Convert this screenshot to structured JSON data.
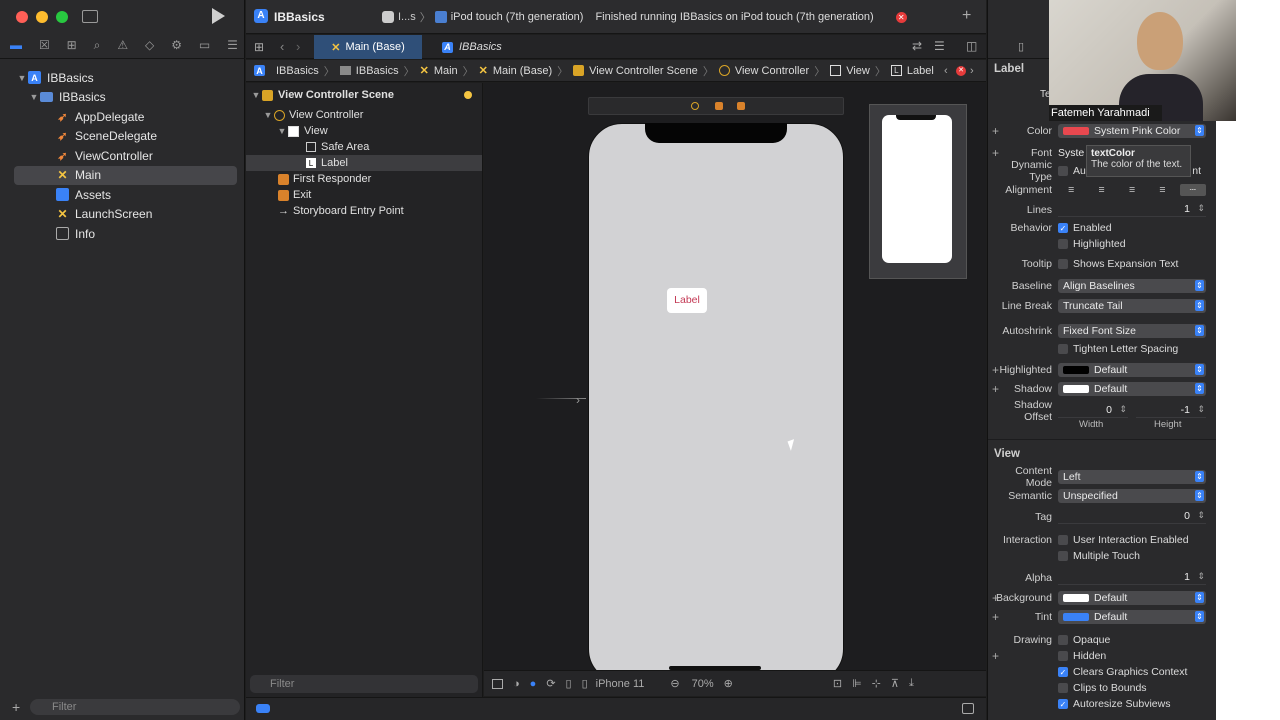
{
  "colors": {
    "accent": "#3a82f7",
    "pink": "#e8484f",
    "label_text": "#c43a55"
  },
  "window": {
    "scheme": "IBBasics",
    "scheme_short": "I...s",
    "device": "iPod touch (7th generation)",
    "status": "Finished running IBBasics on iPod touch (7th generation)"
  },
  "navigator": {
    "items": [
      {
        "label": "IBBasics",
        "icon": "project-icon",
        "level": 0
      },
      {
        "label": "IBBasics",
        "icon": "folder-icon",
        "level": 1
      },
      {
        "label": "AppDelegate",
        "icon": "swift-file-icon",
        "level": 2
      },
      {
        "label": "SceneDelegate",
        "icon": "swift-file-icon",
        "level": 2
      },
      {
        "label": "ViewController",
        "icon": "swift-file-icon",
        "level": 2
      },
      {
        "label": "Main",
        "icon": "storyboard-icon",
        "level": 2
      },
      {
        "label": "Assets",
        "icon": "assets-icon",
        "level": 2
      },
      {
        "label": "LaunchScreen",
        "icon": "storyboard-icon",
        "level": 2
      },
      {
        "label": "Info",
        "icon": "plist-icon",
        "level": 2
      }
    ],
    "filter_placeholder": "Filter"
  },
  "tabs": {
    "active": "Main (Base)",
    "other": "IBBasics"
  },
  "jumpbar": [
    "IBBasics",
    "IBBasics",
    "Main",
    "Main (Base)",
    "View Controller Scene",
    "View Controller",
    "View",
    "Label"
  ],
  "outline": {
    "items": [
      "View Controller Scene",
      "View Controller",
      "View",
      "Safe Area",
      "Label",
      "First Responder",
      "Exit",
      "Storyboard Entry Point"
    ],
    "filter_placeholder": "Filter"
  },
  "canvas": {
    "label_text": "Label",
    "device_name": "iPhone 11",
    "zoom": "70%"
  },
  "inspector": {
    "label_section": "Label",
    "text_label": "Te",
    "color_label": "Color",
    "color_value": "System Pink Color",
    "font_label": "Font",
    "font_value": "Syste",
    "tooltip_title": "textColor",
    "tooltip_body": "The color of the text.",
    "dynamic_label": "Dynamic Type",
    "dynamic_value": "Au",
    "dynamic_suffix": "nt",
    "alignment_label": "Alignment",
    "lines_label": "Lines",
    "lines_value": "1",
    "behavior_label": "Behavior",
    "enabled": "Enabled",
    "highlighted_chk": "Highlighted",
    "tooltip_label": "Tooltip",
    "shows_expansion": "Shows Expansion Text",
    "baseline_label": "Baseline",
    "baseline_value": "Align Baselines",
    "linebreak_label": "Line Break",
    "linebreak_value": "Truncate Tail",
    "autoshrink_label": "Autoshrink",
    "autoshrink_value": "Fixed Font Size",
    "tighten": "Tighten Letter Spacing",
    "highlighted_label": "Highlighted",
    "highlighted_value": "Default",
    "shadow_label": "Shadow",
    "shadow_value": "Default",
    "shadow_offset_label": "Shadow Offset",
    "shadow_w": "0",
    "shadow_h": "-1",
    "width_caption": "Width",
    "height_caption": "Height",
    "view_section": "View",
    "content_mode_label": "Content Mode",
    "content_mode_value": "Left",
    "semantic_label": "Semantic",
    "semantic_value": "Unspecified",
    "tag_label": "Tag",
    "tag_value": "0",
    "interaction_label": "Interaction",
    "user_interaction": "User Interaction Enabled",
    "multiple_touch": "Multiple Touch",
    "alpha_label": "Alpha",
    "alpha_value": "1",
    "background_label": "Background",
    "background_value": "Default",
    "tint_label": "Tint",
    "tint_value": "Default",
    "drawing_label": "Drawing",
    "opaque": "Opaque",
    "hidden": "Hidden",
    "clears": "Clears Graphics Context",
    "clips": "Clips to Bounds",
    "autoresize": "Autoresize Subviews"
  },
  "webcam": {
    "name": "Fatemeh Yarahmadi"
  }
}
